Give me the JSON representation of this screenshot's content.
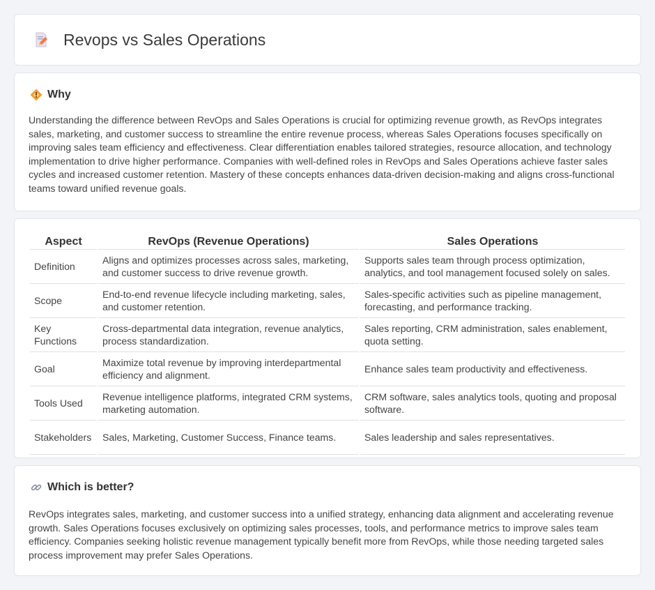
{
  "header": {
    "title": "Revops vs Sales Operations",
    "icon": "document-edit-icon"
  },
  "why": {
    "title": "Why",
    "icon": "diamond-signal-icon",
    "body": "Understanding the difference between RevOps and Sales Operations is crucial for optimizing revenue growth, as RevOps integrates sales, marketing, and customer success to streamline the entire revenue process, whereas Sales Operations focuses specifically on improving sales team efficiency and effectiveness. Clear differentiation enables tailored strategies, resource allocation, and technology implementation to drive higher performance. Companies with well-defined roles in RevOps and Sales Operations achieve faster sales cycles and increased customer retention. Mastery of these concepts enhances data-driven decision-making and aligns cross-functional teams toward unified revenue goals."
  },
  "comparison": {
    "headers": [
      "Aspect",
      "RevOps (Revenue Operations)",
      "Sales Operations"
    ],
    "rows": [
      [
        "Definition",
        "Aligns and optimizes processes across sales, marketing, and customer success to drive revenue growth.",
        "Supports sales team through process optimization, analytics, and tool management focused solely on sales."
      ],
      [
        "Scope",
        "End-to-end revenue lifecycle including marketing, sales, and customer retention.",
        "Sales-specific activities such as pipeline management, forecasting, and performance tracking."
      ],
      [
        "Key Functions",
        "Cross-departmental data integration, revenue analytics, process standardization.",
        "Sales reporting, CRM administration, sales enablement, quota setting."
      ],
      [
        "Goal",
        "Maximize total revenue by improving interdepartmental efficiency and alignment.",
        "Enhance sales team productivity and effectiveness."
      ],
      [
        "Tools Used",
        "Revenue intelligence platforms, integrated CRM systems, marketing automation.",
        "CRM software, sales analytics tools, quoting and proposal software."
      ],
      [
        "Stakeholders",
        "Sales, Marketing, Customer Success, Finance teams.",
        "Sales leadership and sales representatives."
      ]
    ]
  },
  "better": {
    "title": "Which is better?",
    "icon": "link-icon",
    "body": "RevOps integrates sales, marketing, and customer success into a unified strategy, enhancing data alignment and accelerating revenue growth. Sales Operations focuses exclusively on optimizing sales processes, tools, and performance metrics to improve sales team efficiency. Companies seeking holistic revenue management typically benefit more from RevOps, while those needing targeted sales process improvement may prefer Sales Operations."
  },
  "colors": {
    "background": "#f3f4f8",
    "card": "#ffffff",
    "accent_orange": "#f0a030"
  }
}
